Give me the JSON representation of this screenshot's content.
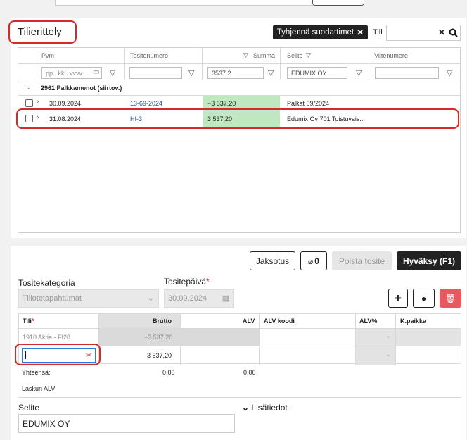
{
  "tilierittely": {
    "title": "Tilierittely",
    "clear_filters": "Tyhjennä suodattimet",
    "tili_label": "Tili",
    "columns": {
      "pvm": "Pvm",
      "tositenumero": "Tositenumero",
      "summa": "Summa",
      "selite": "Selite",
      "viitenumero": "Viitenumero"
    },
    "filters": {
      "date_placeholder": "pp . kk . vvvv",
      "summa": "3537.2",
      "selite": "EDUMIX OY"
    },
    "group": "2961 Palkkamenot (siirtov.)",
    "rows": [
      {
        "pvm": "30.09.2024",
        "tositenumero": "13-69-2024",
        "summa": "−3 537,20",
        "selite": "Palkat 09/2024"
      },
      {
        "pvm": "31.08.2024",
        "tositenumero": "HI-3",
        "summa": "3 537,20",
        "selite": "Edumix Oy 701 Toistuvais..."
      }
    ]
  },
  "voucher": {
    "buttons": {
      "jaksotus": "Jaksotus",
      "attachments": "0",
      "poista": "Poista tosite",
      "hyvaksy": "Hyväksy (F1)"
    },
    "tositekategoria_label": "Tositekategoria",
    "tositekategoria_value": "Tiliotetapahtumat",
    "tositepaiva_label": "Tositepäivä",
    "required_mark": "*",
    "tositepaiva_value": "30.09.2024",
    "columns": {
      "tili": "Tili",
      "brutto": "Brutto",
      "alv": "ALV",
      "alv_koodi": "ALV koodi",
      "alv_pct": "ALV%",
      "kpaikka": "K.paikka"
    },
    "rows": [
      {
        "tili": "1910 Aktia - FI28",
        "brutto": "−3 537,20"
      },
      {
        "tili": "",
        "brutto": "3 537,20"
      }
    ],
    "totals_label": "Yhteensä:",
    "total_brutto": "0,00",
    "total_alv": "0,00",
    "laskun_alv": "Laskun ALV",
    "selite_label": "Selite",
    "selite_value": "EDUMIX OY",
    "lisatiedot": "Lisätiedot"
  },
  "colors": {
    "accent_red": "#d42a2a",
    "green_cell": "#bfe8c0",
    "dark_button": "#222222"
  }
}
